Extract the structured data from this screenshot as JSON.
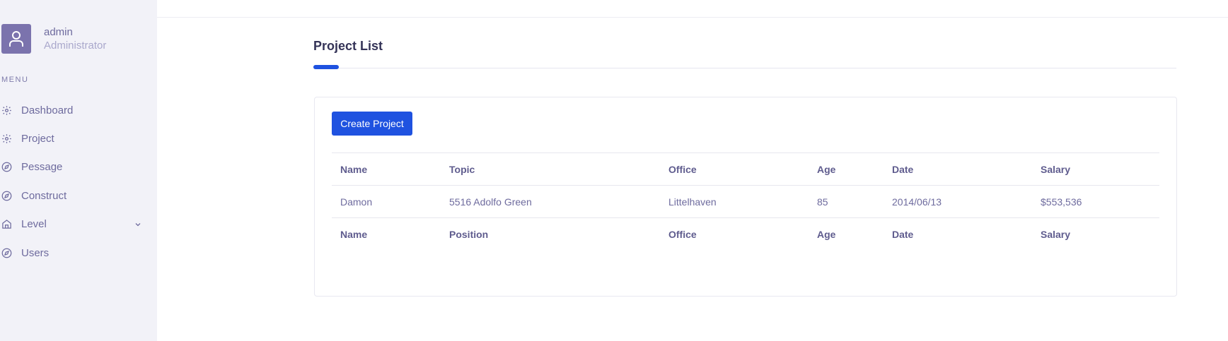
{
  "user": {
    "name": "admin",
    "role": "Administrator"
  },
  "menu": {
    "title": "MENU",
    "items": [
      {
        "label": "Dashboard",
        "icon": "gear-icon"
      },
      {
        "label": "Project",
        "icon": "gear-icon"
      },
      {
        "label": "Pessage",
        "icon": "compass-icon"
      },
      {
        "label": "Construct",
        "icon": "compass-icon"
      },
      {
        "label": "Level",
        "icon": "home-icon",
        "expandable": true
      },
      {
        "label": "Users",
        "icon": "compass-icon"
      }
    ]
  },
  "page": {
    "title": "Project List"
  },
  "toolbar": {
    "create_label": "Create Project"
  },
  "table": {
    "header": [
      "Name",
      "Topic",
      "Office",
      "Age",
      "Date",
      "Salary"
    ],
    "rows": [
      [
        "Damon",
        "5516 Adolfo Green",
        "Littelhaven",
        "85",
        "2014/06/13",
        "$553,536"
      ]
    ],
    "footer": [
      "Name",
      "Position",
      "Office",
      "Age",
      "Date",
      "Salary"
    ]
  },
  "colors": {
    "accent": "#1f52e0",
    "sidebar_bg": "#f2f2f8",
    "avatar_bg": "#7b73ad",
    "text": "#6e6b9e"
  }
}
